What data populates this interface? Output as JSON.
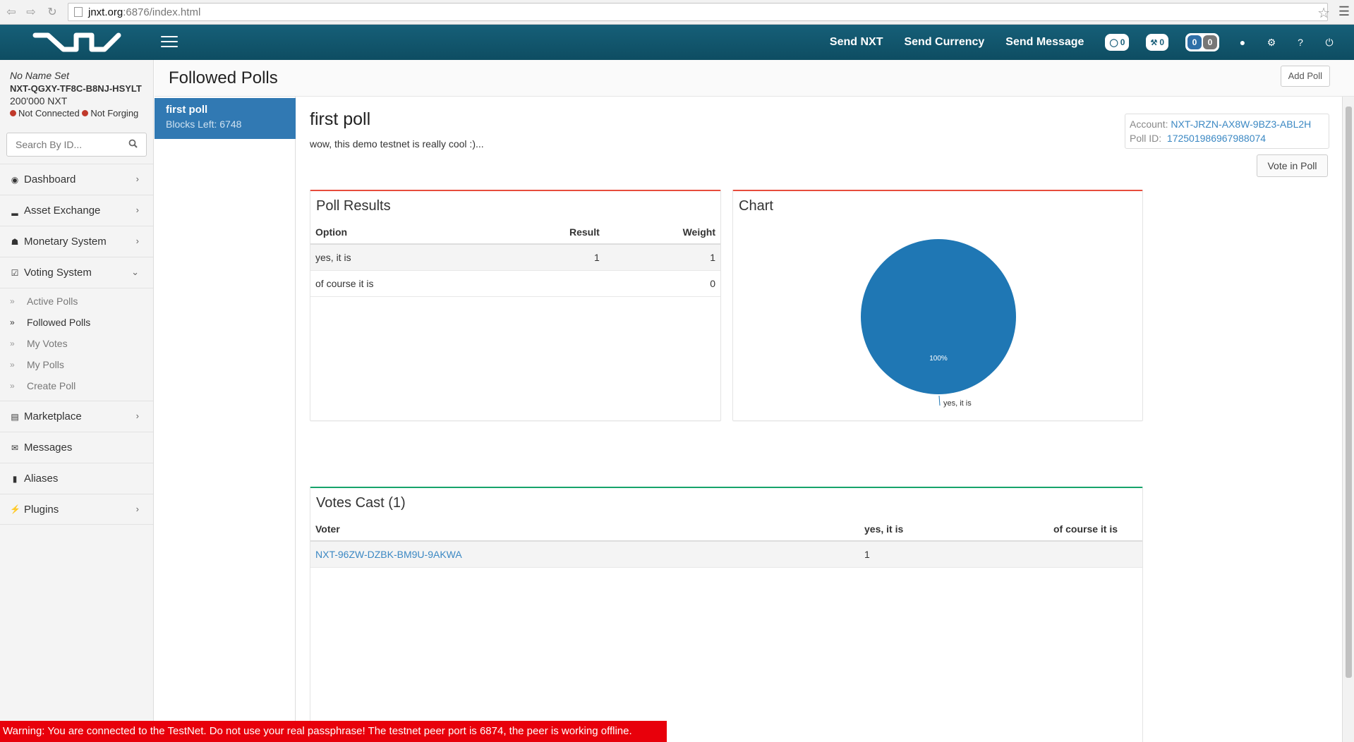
{
  "browser": {
    "url_host": "jnxt.org",
    "url_path": ":6876/index.html"
  },
  "topnav": {
    "send_nxt": "Send NXT",
    "send_currency": "Send Currency",
    "send_message": "Send Message",
    "transactions_count": "0",
    "blocks_count": "0",
    "messages_count_a": "0",
    "messages_count_b": "0"
  },
  "account": {
    "name": "No Name Set",
    "id": "NXT-QGXY-TF8C-B8NJ-HSYLT",
    "balance": "200'000 NXT",
    "status_connected": "Not Connected",
    "status_forging": "Not Forging"
  },
  "search": {
    "placeholder": "Search By ID..."
  },
  "sidebar": {
    "items": [
      {
        "label": "Dashboard",
        "icon": "dashboard-icon"
      },
      {
        "label": "Asset Exchange",
        "icon": "signal-icon"
      },
      {
        "label": "Monetary System",
        "icon": "bank-icon"
      },
      {
        "label": "Voting System",
        "icon": "check-square-icon"
      },
      {
        "label": "Marketplace",
        "icon": "cart-icon"
      },
      {
        "label": "Messages",
        "icon": "envelope-icon"
      },
      {
        "label": "Aliases",
        "icon": "bookmark-icon"
      },
      {
        "label": "Plugins",
        "icon": "plug-icon"
      }
    ],
    "voting_sub": [
      "Active Polls",
      "Followed Polls",
      "My Votes",
      "My Polls",
      "Create Poll"
    ]
  },
  "header": {
    "title": "Followed Polls",
    "add_poll": "Add Poll"
  },
  "poll_list": [
    {
      "title": "first poll",
      "subtitle": "Blocks Left: 6748"
    }
  ],
  "poll": {
    "title": "first poll",
    "description": "wow, this demo testnet is really cool :)...",
    "account_label": "Account:",
    "account_value": "NXT-JRZN-AX8W-9BZ3-ABL2H",
    "poll_id_label": "Poll ID:",
    "poll_id_value": "172501986967988074",
    "vote_button": "Vote in Poll"
  },
  "results": {
    "title": "Poll Results",
    "headers": [
      "Option",
      "Result",
      "Weight"
    ],
    "rows": [
      {
        "option": "yes, it is",
        "result": "1",
        "weight": "1"
      },
      {
        "option": "of course it is",
        "result": "",
        "weight": "0"
      }
    ]
  },
  "chart_panel": {
    "title": "Chart"
  },
  "chart_data": {
    "type": "pie",
    "slices": [
      {
        "label": "yes, it is",
        "value": 100,
        "display": "100%",
        "color": "#1f77b4"
      }
    ]
  },
  "votes": {
    "title": "Votes Cast (1)",
    "headers": [
      "Voter",
      "yes, it is",
      "of course it is"
    ],
    "rows": [
      {
        "voter": "NXT-96ZW-DZBK-BM9U-9AKWA",
        "yes": "1",
        "course": ""
      }
    ]
  },
  "warning": "Warning: You are connected to the TestNet. Do not use your real passphrase! The testnet peer port is 6874, the peer is working offline.",
  "colors": {
    "nav_bg": "#165f78",
    "accent_blue": "#3179b3",
    "red_accent": "#e74c3c",
    "green_accent": "#16a36a",
    "warning_bg": "#e8000b"
  }
}
